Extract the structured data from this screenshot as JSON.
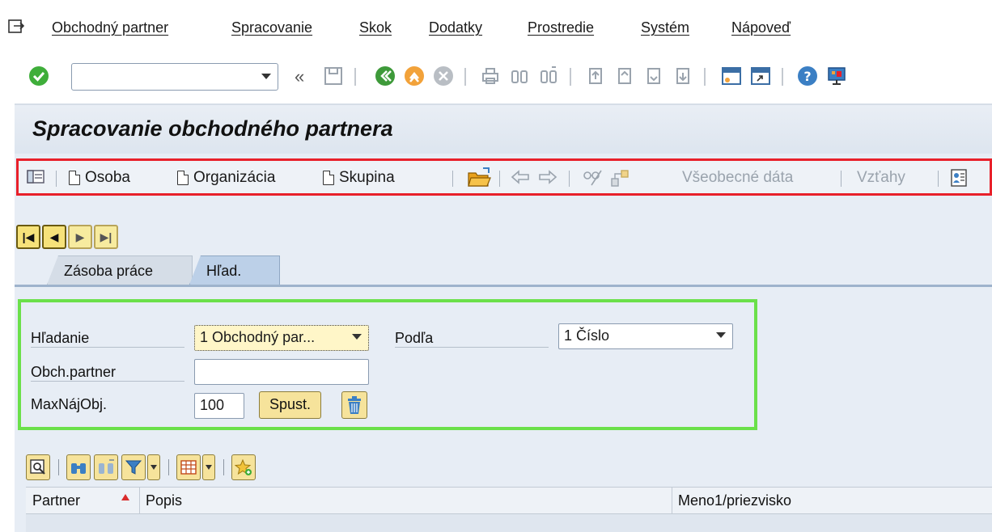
{
  "menu": {
    "items": [
      "Obchodný partner",
      "Spracovanie",
      "Skok",
      "Dodatky",
      "Prostredie",
      "Systém",
      "Nápoveď"
    ]
  },
  "std_toolbar": {
    "command_field_value": "",
    "back_chevrons": "«"
  },
  "screen": {
    "title": "Spracovanie obchodného partnera"
  },
  "app_toolbar": {
    "person": "Osoba",
    "organization": "Organizácia",
    "group": "Skupina",
    "general_data": "Všeobecné dáta",
    "relations": "Vzťahy"
  },
  "nav": {
    "first": "|◀",
    "prev": "◀",
    "next": "▶",
    "last": "▶|"
  },
  "tabs": [
    "Zásoba práce",
    "Hľad."
  ],
  "search": {
    "search_label": "Hľadanie",
    "search_value": "1 Obchodný par...",
    "by_label": "Podľa",
    "by_value": "1 Číslo",
    "partner_label": "Obch.partner",
    "partner_value": "",
    "maxhits_label": "MaxNájObj.",
    "maxhits_value": "100",
    "start_button": "Spust."
  },
  "grid": {
    "columns": [
      "Partner",
      "Popis",
      "Meno1/priezvisko"
    ]
  },
  "colors": {
    "red_highlight": "#e8202a",
    "green_highlight": "#6be04a",
    "sap_button": "#f6e39b",
    "content_bg": "#e7edf5"
  }
}
